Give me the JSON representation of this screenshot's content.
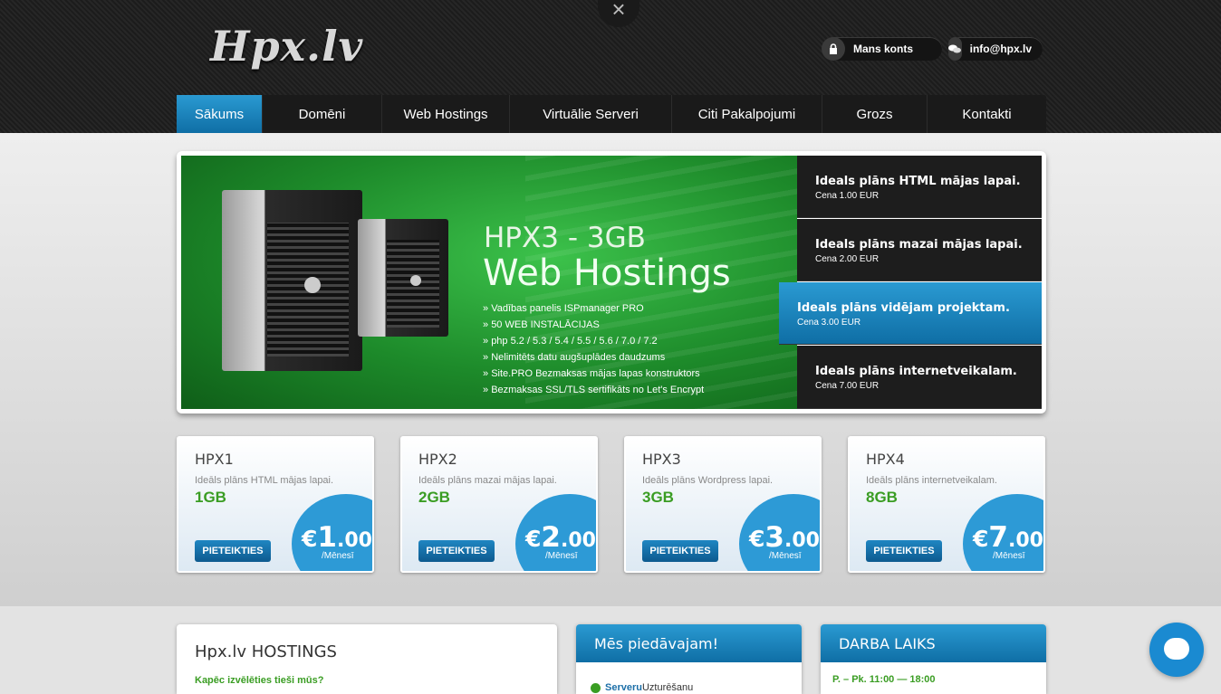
{
  "header": {
    "logo": "Hpx.lv",
    "close_glyph": "×",
    "account_label": "Mans konts",
    "email_label": "info@hpx.lv"
  },
  "nav": {
    "items": [
      "Sākums",
      "Domēni",
      "Web Hostings",
      "Virtuālie Serveri",
      "Citi Pakalpojumi",
      "Grozs",
      "Kontakti"
    ],
    "active": "Sākums"
  },
  "banner": {
    "title_line1": "HPX3 - 3GB",
    "title_line2": "Web Hostings",
    "features": [
      "Vadības panelis ISPmanager PRO",
      "50 WEB INSTALĀCIJAS",
      "php 5.2 / 5.3 / 5.4 / 5.5 / 5.6 / 7.0 / 7.2",
      "Nelimitēts datu augšuplādes daudzums",
      "Site.PRO Bezmaksas mājas lapas konstruktors",
      "Bezmaksas SSL/TLS sertifikāts no Let's Encrypt"
    ]
  },
  "plan_tabs": [
    {
      "title": "Ideals plāns HTML mājas lapai.",
      "price": "Cena 1.00 EUR"
    },
    {
      "title": "Ideals plāns mazai mājas lapai.",
      "price": "Cena 2.00 EUR"
    },
    {
      "title": "Ideals plāns vidējam projektam.",
      "price": "Cena 3.00 EUR"
    },
    {
      "title": "Ideals plāns internetveikalam.",
      "price": "Cena 7.00 EUR"
    }
  ],
  "plan_cards": [
    {
      "name": "HPX1",
      "desc": "Ideāls plāns HTML mājas lapai.",
      "size": "1GB",
      "button": "PIETEIKTIES",
      "currency": "€",
      "price_int": "1",
      "price_dec": ".00",
      "period": "/Mēnesī"
    },
    {
      "name": "HPX2",
      "desc": "Ideāls plāns mazai mājas lapai.",
      "size": "2GB",
      "button": "PIETEIKTIES",
      "currency": "€",
      "price_int": "2",
      "price_dec": ".00",
      "period": "/Mēnesī"
    },
    {
      "name": "HPX3",
      "desc": "Ideāls plāns Wordpress lapai.",
      "size": "3GB",
      "button": "PIETEIKTIES",
      "currency": "€",
      "price_int": "3",
      "price_dec": ".00",
      "period": "/Mēnesī"
    },
    {
      "name": "HPX4",
      "desc": "Ideāls plāns internetveikalam.",
      "size": "8GB",
      "button": "PIETEIKTIES",
      "currency": "€",
      "price_int": "7",
      "price_dec": ".00",
      "period": "/Mēnesī"
    }
  ],
  "about": {
    "title": "Hpx.lv HOSTINGS",
    "subtitle": "Kapēc izvēlēties tieši mūs?"
  },
  "offer": {
    "title": "Mēs piedāvajam!",
    "item_bold": "Serveru",
    "item_rest": " Uzturēšanu"
  },
  "hours": {
    "title": "DARBA LAIKS",
    "line1": "P. – Pk. 11:00 — 18:00"
  },
  "colors": {
    "accent": "#1c86c4",
    "green": "#3a9d23"
  },
  "icons": {
    "account": "lock-icon",
    "email": "chat-bubble-icon",
    "check": "check-icon",
    "chat": "chat-icon"
  }
}
